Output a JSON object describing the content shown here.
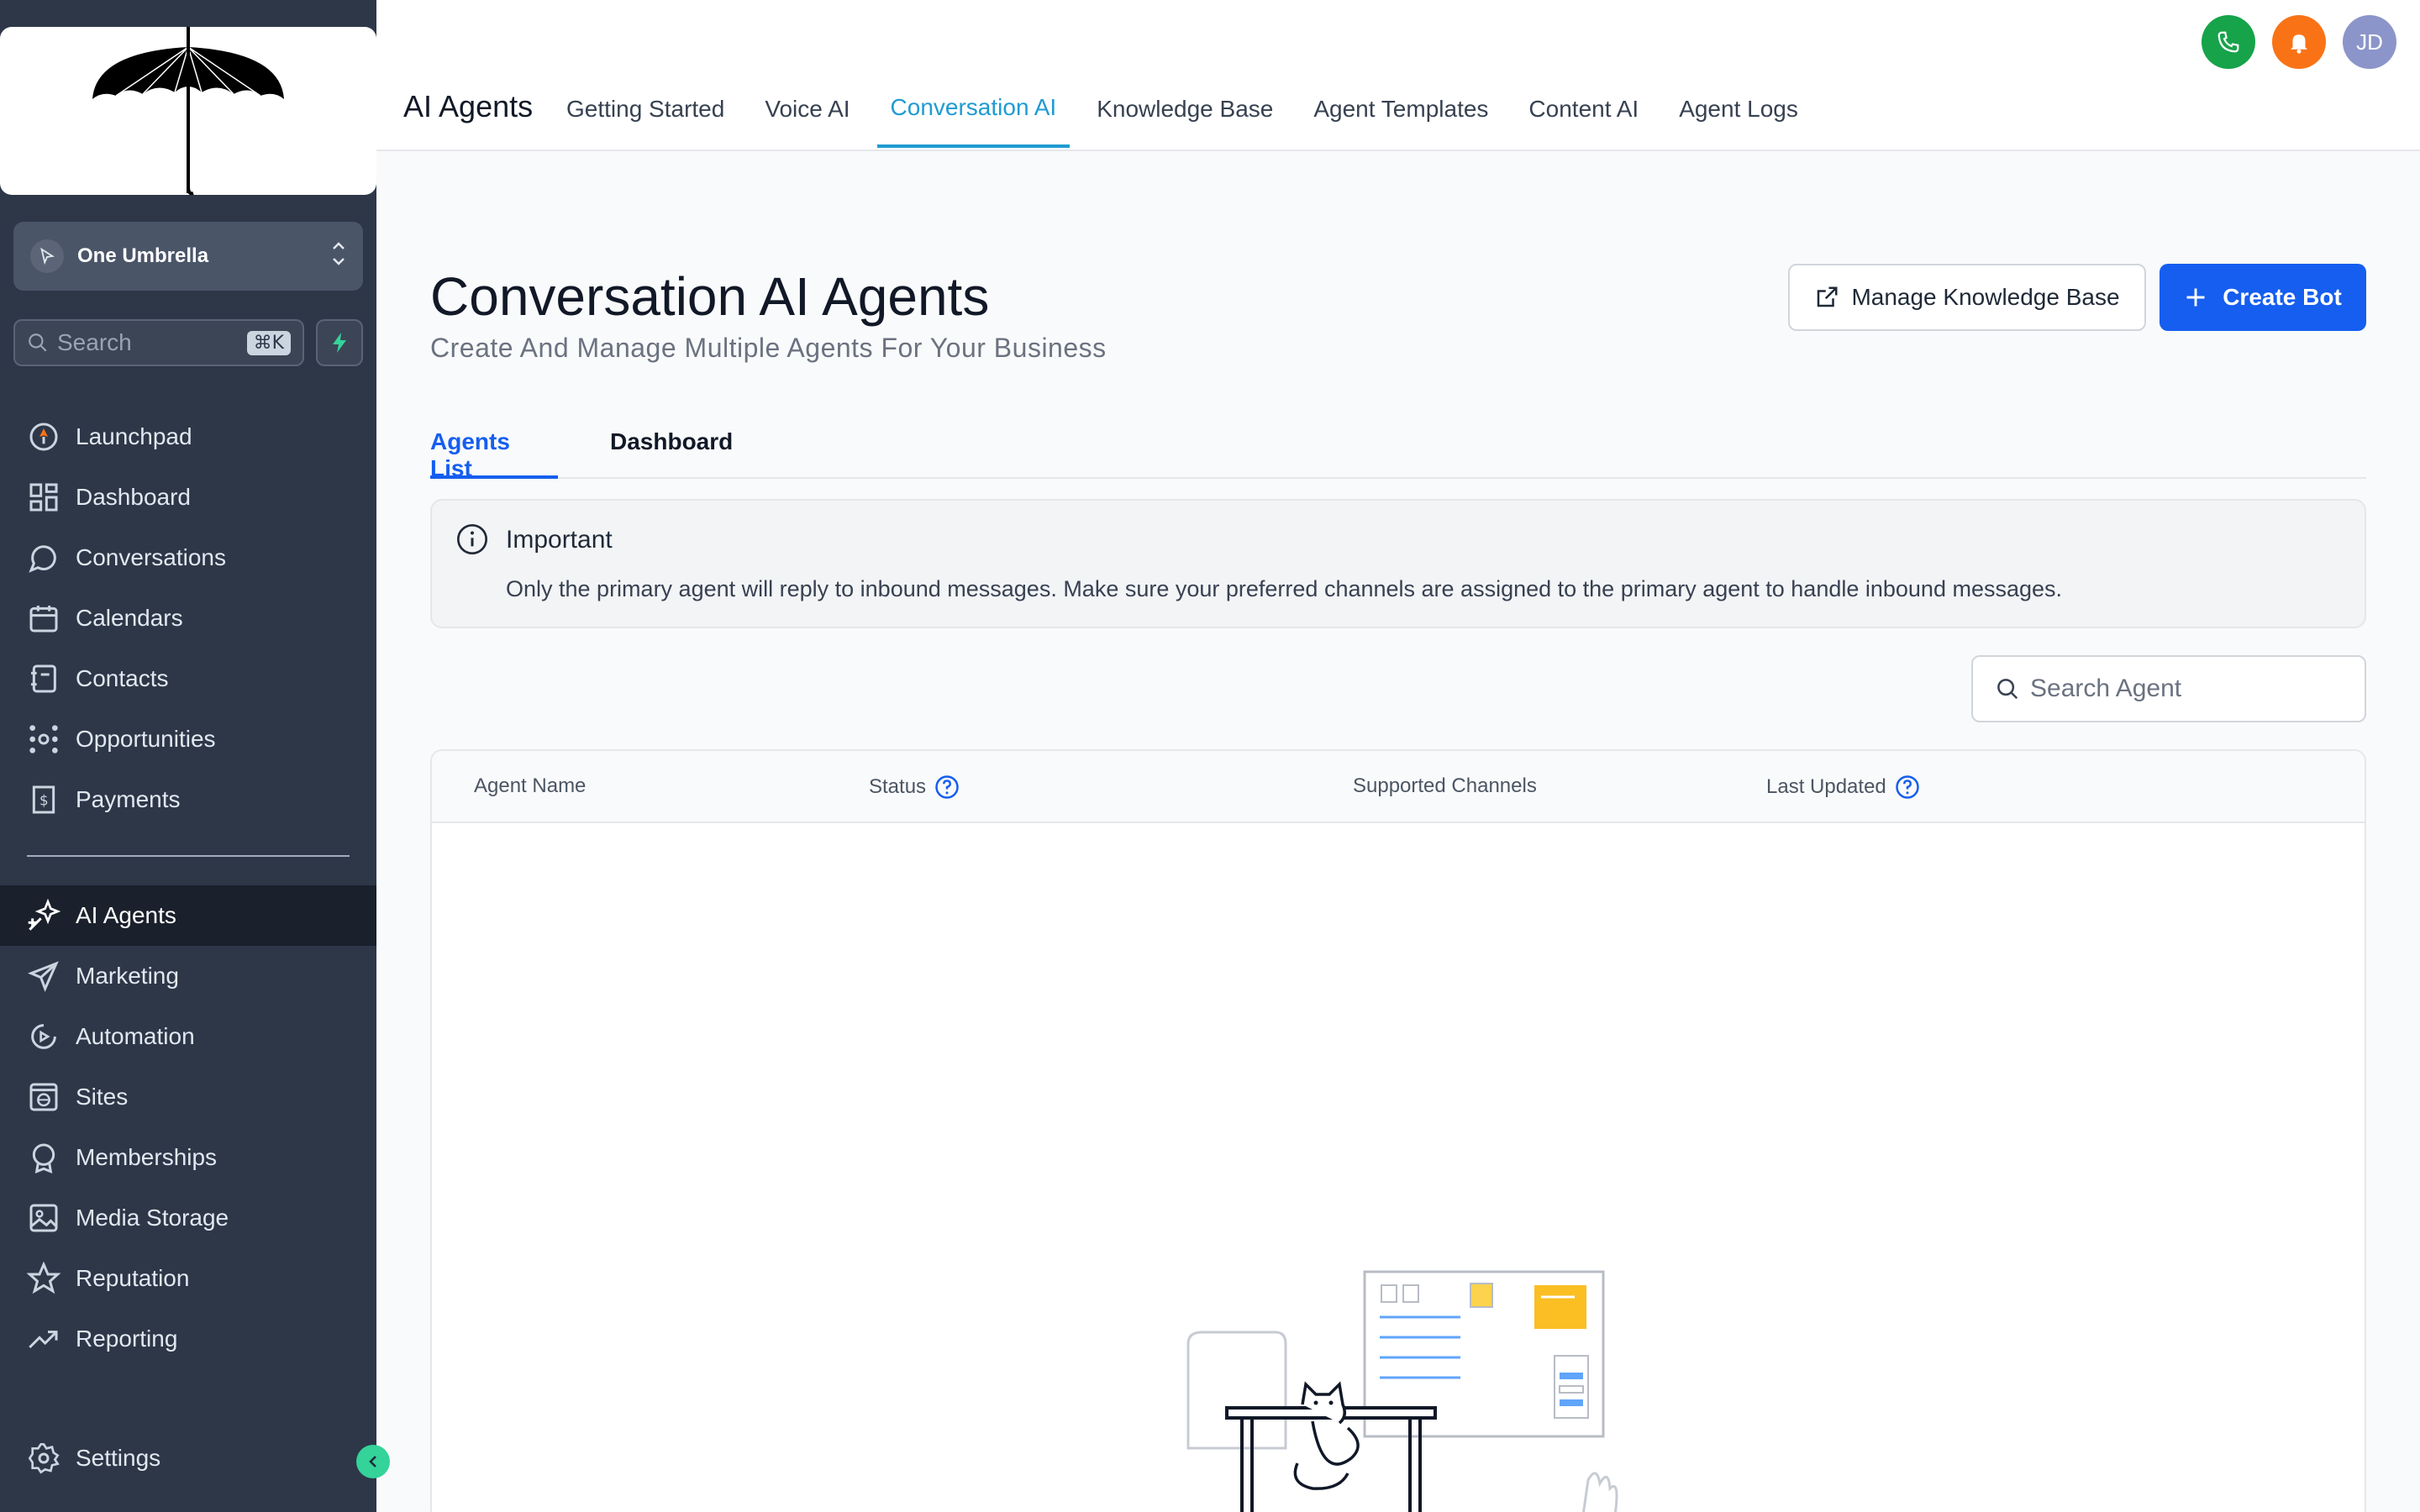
{
  "sidebar": {
    "account_name": "One Umbrella",
    "search_placeholder": "Search",
    "search_shortcut": "⌘K",
    "items_top": [
      {
        "label": "Launchpad",
        "icon": "rocket-icon"
      },
      {
        "label": "Dashboard",
        "icon": "grid-icon"
      },
      {
        "label": "Conversations",
        "icon": "chat-icon"
      },
      {
        "label": "Calendars",
        "icon": "calendar-icon"
      },
      {
        "label": "Contacts",
        "icon": "contacts-icon"
      },
      {
        "label": "Opportunities",
        "icon": "opportunities-icon"
      },
      {
        "label": "Payments",
        "icon": "payments-icon"
      }
    ],
    "items_bottom": [
      {
        "label": "AI Agents",
        "icon": "sparkle-icon",
        "active": true
      },
      {
        "label": "Marketing",
        "icon": "send-icon"
      },
      {
        "label": "Automation",
        "icon": "automation-icon"
      },
      {
        "label": "Sites",
        "icon": "globe-icon"
      },
      {
        "label": "Memberships",
        "icon": "badge-icon"
      },
      {
        "label": "Media Storage",
        "icon": "image-icon"
      },
      {
        "label": "Reputation",
        "icon": "star-icon"
      },
      {
        "label": "Reporting",
        "icon": "trend-icon"
      }
    ],
    "settings_label": "Settings"
  },
  "topbar": {
    "app_title": "AI Agents",
    "tabs": [
      {
        "label": "Getting Started"
      },
      {
        "label": "Voice AI"
      },
      {
        "label": "Conversation AI",
        "active": true
      },
      {
        "label": "Knowledge Base"
      },
      {
        "label": "Agent Templates"
      },
      {
        "label": "Content AI"
      },
      {
        "label": "Agent Logs"
      }
    ],
    "avatar_initials": "JD"
  },
  "main": {
    "title": "Conversation AI Agents",
    "subtitle": "Create And Manage Multiple Agents For Your Business",
    "manage_kb_label": "Manage Knowledge Base",
    "create_bot_label": "Create Bot",
    "subtabs": [
      {
        "label": "Agents List",
        "active": true
      },
      {
        "label": "Dashboard"
      }
    ],
    "notice": {
      "title": "Important",
      "body": "Only the primary agent will reply to inbound messages. Make sure your preferred channels are assigned to the primary agent to handle inbound messages."
    },
    "search_placeholder": "Search Agent",
    "table": {
      "columns": [
        "Agent Name",
        "Status",
        "Supported Channels",
        "Last Updated"
      ]
    }
  },
  "colors": {
    "sidebar_bg": "#2d3748",
    "primary": "#155eef",
    "tab_active": "#1f9bd1",
    "phone": "#16a34a",
    "bell": "#f97316"
  }
}
